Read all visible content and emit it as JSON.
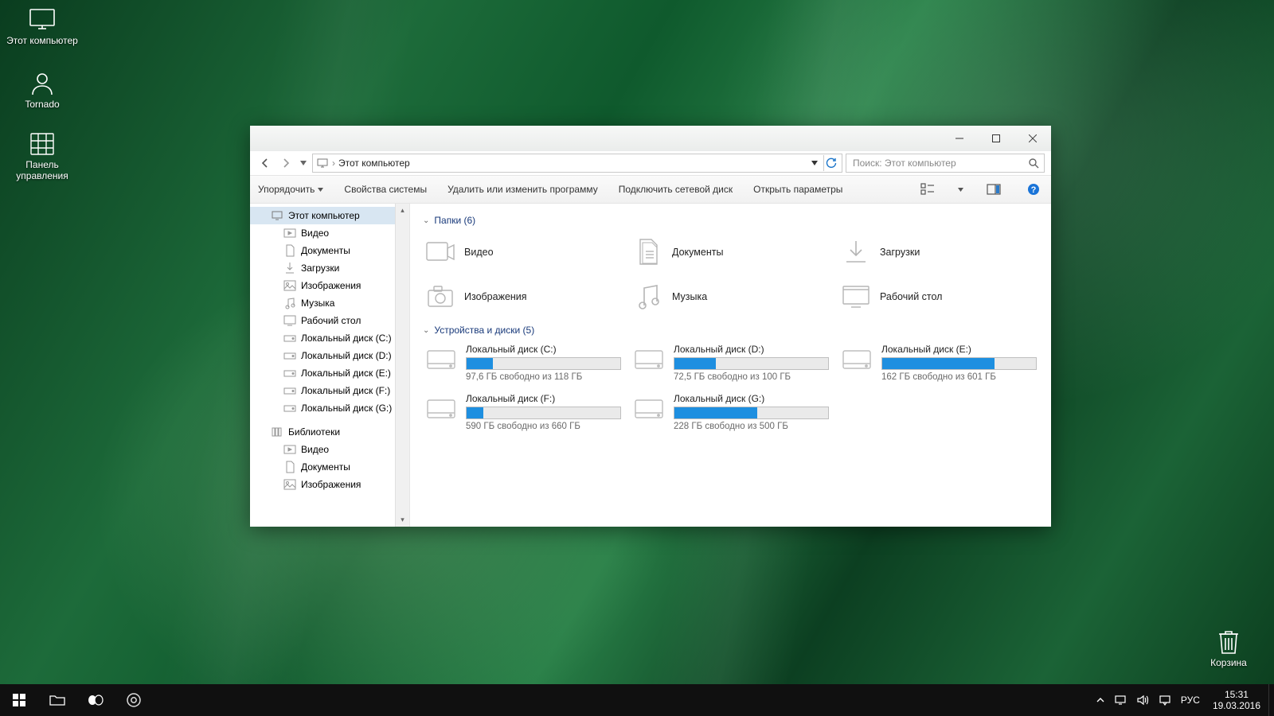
{
  "desktop_icons": {
    "this_pc": "Этот компьютер",
    "tornado": "Tornado",
    "control_panel": "Панель управления",
    "recycle_bin": "Корзина"
  },
  "taskbar": {
    "time": "15:31",
    "date": "19.03.2016",
    "lang": "РУС"
  },
  "explorer": {
    "breadcrumb": "Этот компьютер",
    "search_placeholder": "Поиск: Этот компьютер",
    "toolbar": {
      "organize": "Упорядочить",
      "sysprops": "Свойства системы",
      "uninstall": "Удалить или изменить программу",
      "mapdrive": "Подключить сетевой диск",
      "opensettings": "Открыть параметры"
    },
    "nav": {
      "this_pc": "Этот компьютер",
      "videos": "Видео",
      "documents": "Документы",
      "downloads": "Загрузки",
      "pictures": "Изображения",
      "music": "Музыка",
      "desktop": "Рабочий стол",
      "disk_c": "Локальный диск (C:)",
      "disk_d": "Локальный диск (D:)",
      "disk_e": "Локальный диск (E:)",
      "disk_f": "Локальный диск (F:)",
      "disk_g": "Локальный диск (G:)",
      "libraries": "Библиотеки",
      "lib_videos": "Видео",
      "lib_documents": "Документы",
      "lib_pictures": "Изображения"
    },
    "groups": {
      "folders_hdr": "Папки (6)",
      "drives_hdr": "Устройства и диски (5)"
    },
    "folders": {
      "videos": "Видео",
      "documents": "Документы",
      "downloads": "Загрузки",
      "pictures": "Изображения",
      "music": "Музыка",
      "desktop": "Рабочий стол"
    },
    "drives": {
      "c": {
        "name": "Локальный диск (C:)",
        "free": "97,6 ГБ свободно из 118 ГБ",
        "fill": 17
      },
      "d": {
        "name": "Локальный диск (D:)",
        "free": "72,5 ГБ свободно из 100 ГБ",
        "fill": 27
      },
      "e": {
        "name": "Локальный диск (E:)",
        "free": "162 ГБ свободно из 601 ГБ",
        "fill": 73
      },
      "f": {
        "name": "Локальный диск (F:)",
        "free": "590 ГБ свободно из 660 ГБ",
        "fill": 11
      },
      "g": {
        "name": "Локальный диск (G:)",
        "free": "228 ГБ свободно из 500 ГБ",
        "fill": 54
      }
    }
  }
}
